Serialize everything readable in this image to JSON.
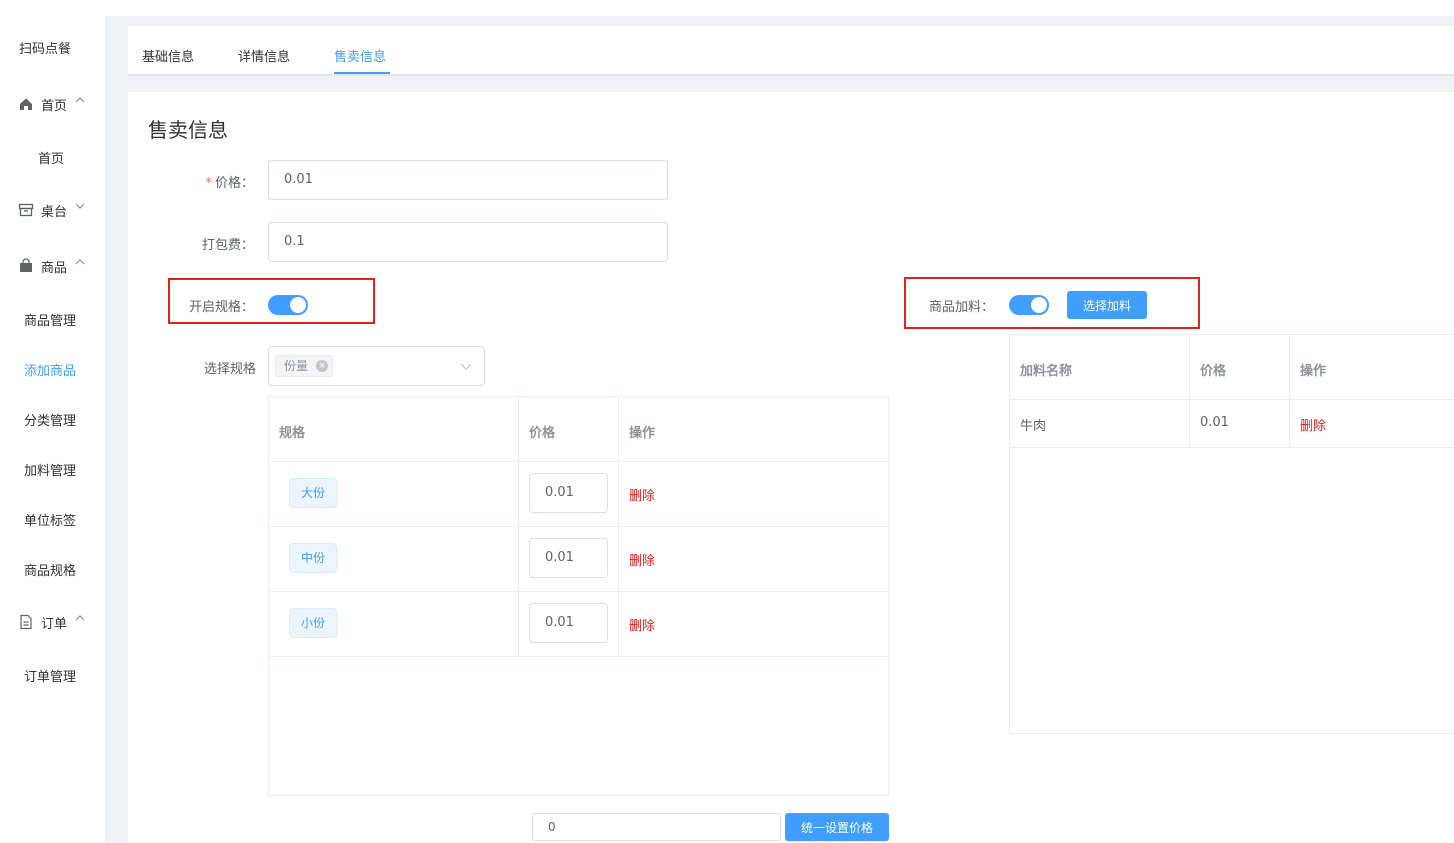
{
  "app": {
    "brand": "扫码点餐"
  },
  "sidebar": {
    "groups": [
      {
        "label": "首页",
        "icon": "home-icon",
        "arrow": "up"
      },
      {
        "label": "桌台",
        "icon": "table-icon",
        "arrow": "down"
      },
      {
        "label": "商品",
        "icon": "bag-icon",
        "arrow": "up"
      },
      {
        "label": "订单",
        "icon": "document-icon",
        "arrow": "up"
      }
    ],
    "items": [
      {
        "label": "首页",
        "active": false
      },
      {
        "label": "商品管理",
        "active": false
      },
      {
        "label": "添加商品",
        "active": true
      },
      {
        "label": "分类管理",
        "active": false
      },
      {
        "label": "加料管理",
        "active": false
      },
      {
        "label": "单位标签",
        "active": false
      },
      {
        "label": "商品规格",
        "active": false
      },
      {
        "label": "订单管理",
        "active": false
      }
    ]
  },
  "tabs": [
    {
      "label": "基础信息",
      "active": false
    },
    {
      "label": "详情信息",
      "active": false
    },
    {
      "label": "售卖信息",
      "active": true
    }
  ],
  "form": {
    "title": "售卖信息",
    "price": {
      "required_mark": "*",
      "label": "价格：",
      "value": "0.01"
    },
    "packing_fee": {
      "label": "打包费：",
      "value": "0.1"
    },
    "spec_switch": {
      "label": "开启规格：",
      "on": true
    },
    "addon_switch": {
      "label": "商品加料：",
      "on": true
    },
    "choose_addon_button": "选择加料",
    "select_spec": {
      "label": "选择规格",
      "tags": [
        "份量"
      ],
      "tag_close": "×"
    }
  },
  "spec_table": {
    "headers": [
      "规格",
      "价格",
      "操作"
    ],
    "rows": [
      {
        "spec": "大份",
        "price": "0.01",
        "action": "删除"
      },
      {
        "spec": "中份",
        "price": "0.01",
        "action": "删除"
      },
      {
        "spec": "小份",
        "price": "0.01",
        "action": "删除"
      }
    ]
  },
  "addon_table": {
    "headers": [
      "加料名称",
      "价格",
      "操作"
    ],
    "rows": [
      {
        "name": "牛肉",
        "price": "0.01",
        "action": "删除"
      }
    ]
  },
  "bulk_price": {
    "value": "0",
    "button": "统一设置价格"
  },
  "colors": {
    "accent": "#409eff",
    "danger": "#f01c1c",
    "highlight_box": "#e52020"
  }
}
